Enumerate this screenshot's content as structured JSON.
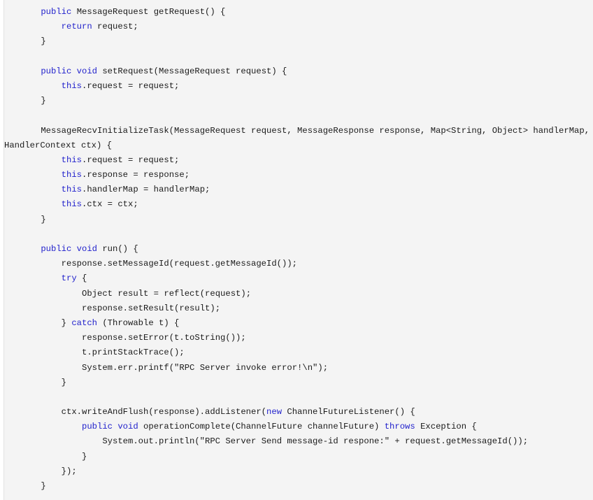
{
  "viewer": {
    "kind": "code-snippet",
    "language": "Java",
    "background_color": "#f4f4f4",
    "gutter_color": "#ffffff",
    "text_color": "#1a1a1a",
    "keyword_color": "#2222cc",
    "font_size_px": 12,
    "line_height_px": 21,
    "tab_size_spaces": 4
  },
  "code": {
    "lines": [
      {
        "id": 1,
        "indent": 1,
        "tokens": [
          {
            "t": "public",
            "k": true
          },
          {
            "t": " MessageRequest getRequest() {",
            "k": false
          }
        ]
      },
      {
        "id": 2,
        "indent": 2,
        "tokens": [
          {
            "t": "return",
            "k": true
          },
          {
            "t": " request;",
            "k": false
          }
        ]
      },
      {
        "id": 3,
        "indent": 1,
        "tokens": [
          {
            "t": "}",
            "k": false
          }
        ]
      },
      {
        "id": 4,
        "indent": 0,
        "tokens": [
          {
            "t": "",
            "k": false
          }
        ]
      },
      {
        "id": 5,
        "indent": 1,
        "tokens": [
          {
            "t": "public void",
            "k": true
          },
          {
            "t": " setRequest(MessageRequest request) {",
            "k": false
          }
        ]
      },
      {
        "id": 6,
        "indent": 2,
        "tokens": [
          {
            "t": "this",
            "k": true
          },
          {
            "t": ".request = request;",
            "k": false
          }
        ]
      },
      {
        "id": 7,
        "indent": 1,
        "tokens": [
          {
            "t": "}",
            "k": false
          }
        ]
      },
      {
        "id": 8,
        "indent": 0,
        "tokens": [
          {
            "t": "",
            "k": false
          }
        ]
      },
      {
        "id": 9,
        "indent": 1,
        "tokens": [
          {
            "t": "MessageRecvInitializeTask(MessageRequest request, MessageResponse response, Map<String, Object> handlerMap, Channel",
            "k": false
          }
        ]
      },
      {
        "id": 10,
        "indent": 0,
        "continuation": true,
        "tokens": [
          {
            "t": "HandlerContext ctx) {",
            "k": false
          }
        ]
      },
      {
        "id": 11,
        "indent": 2,
        "tokens": [
          {
            "t": "this",
            "k": true
          },
          {
            "t": ".request = request;",
            "k": false
          }
        ]
      },
      {
        "id": 12,
        "indent": 2,
        "tokens": [
          {
            "t": "this",
            "k": true
          },
          {
            "t": ".response = response;",
            "k": false
          }
        ]
      },
      {
        "id": 13,
        "indent": 2,
        "tokens": [
          {
            "t": "this",
            "k": true
          },
          {
            "t": ".handlerMap = handlerMap;",
            "k": false
          }
        ]
      },
      {
        "id": 14,
        "indent": 2,
        "tokens": [
          {
            "t": "this",
            "k": true
          },
          {
            "t": ".ctx = ctx;",
            "k": false
          }
        ]
      },
      {
        "id": 15,
        "indent": 1,
        "tokens": [
          {
            "t": "}",
            "k": false
          }
        ]
      },
      {
        "id": 16,
        "indent": 0,
        "tokens": [
          {
            "t": "",
            "k": false
          }
        ]
      },
      {
        "id": 17,
        "indent": 1,
        "tokens": [
          {
            "t": "public void",
            "k": true
          },
          {
            "t": " run() {",
            "k": false
          }
        ]
      },
      {
        "id": 18,
        "indent": 2,
        "tokens": [
          {
            "t": "response.setMessageId(request.getMessageId());",
            "k": false
          }
        ]
      },
      {
        "id": 19,
        "indent": 2,
        "tokens": [
          {
            "t": "try",
            "k": true
          },
          {
            "t": " {",
            "k": false
          }
        ]
      },
      {
        "id": 20,
        "indent": 3,
        "tokens": [
          {
            "t": "Object result = reflect(request);",
            "k": false
          }
        ]
      },
      {
        "id": 21,
        "indent": 3,
        "tokens": [
          {
            "t": "response.setResult(result);",
            "k": false
          }
        ]
      },
      {
        "id": 22,
        "indent": 2,
        "tokens": [
          {
            "t": "} ",
            "k": false
          },
          {
            "t": "catch",
            "k": true
          },
          {
            "t": " (Throwable t) {",
            "k": false
          }
        ]
      },
      {
        "id": 23,
        "indent": 3,
        "tokens": [
          {
            "t": "response.setError(t.toString());",
            "k": false
          }
        ]
      },
      {
        "id": 24,
        "indent": 3,
        "tokens": [
          {
            "t": "t.printStackTrace();",
            "k": false
          }
        ]
      },
      {
        "id": 25,
        "indent": 3,
        "tokens": [
          {
            "t": "System.err.printf(\"RPC Server invoke error!\\n\");",
            "k": false
          }
        ]
      },
      {
        "id": 26,
        "indent": 2,
        "tokens": [
          {
            "t": "}",
            "k": false
          }
        ]
      },
      {
        "id": 27,
        "indent": 0,
        "tokens": [
          {
            "t": "",
            "k": false
          }
        ]
      },
      {
        "id": 28,
        "indent": 2,
        "tokens": [
          {
            "t": "ctx.writeAndFlush(response).addListener(",
            "k": false
          },
          {
            "t": "new",
            "k": true
          },
          {
            "t": " ChannelFutureListener() {",
            "k": false
          }
        ]
      },
      {
        "id": 29,
        "indent": 3,
        "tokens": [
          {
            "t": "public void",
            "k": true
          },
          {
            "t": " operationComplete(ChannelFuture channelFuture) ",
            "k": false
          },
          {
            "t": "throws",
            "k": true
          },
          {
            "t": " Exception {",
            "k": false
          }
        ]
      },
      {
        "id": 30,
        "indent": 4,
        "tokens": [
          {
            "t": "System.out.println(\"RPC Server Send message-id respone:\" + request.getMessageId());",
            "k": false
          }
        ]
      },
      {
        "id": 31,
        "indent": 3,
        "tokens": [
          {
            "t": "}",
            "k": false
          }
        ]
      },
      {
        "id": 32,
        "indent": 2,
        "tokens": [
          {
            "t": "});",
            "k": false
          }
        ]
      },
      {
        "id": 33,
        "indent": 1,
        "tokens": [
          {
            "t": "}",
            "k": false
          }
        ]
      }
    ]
  }
}
